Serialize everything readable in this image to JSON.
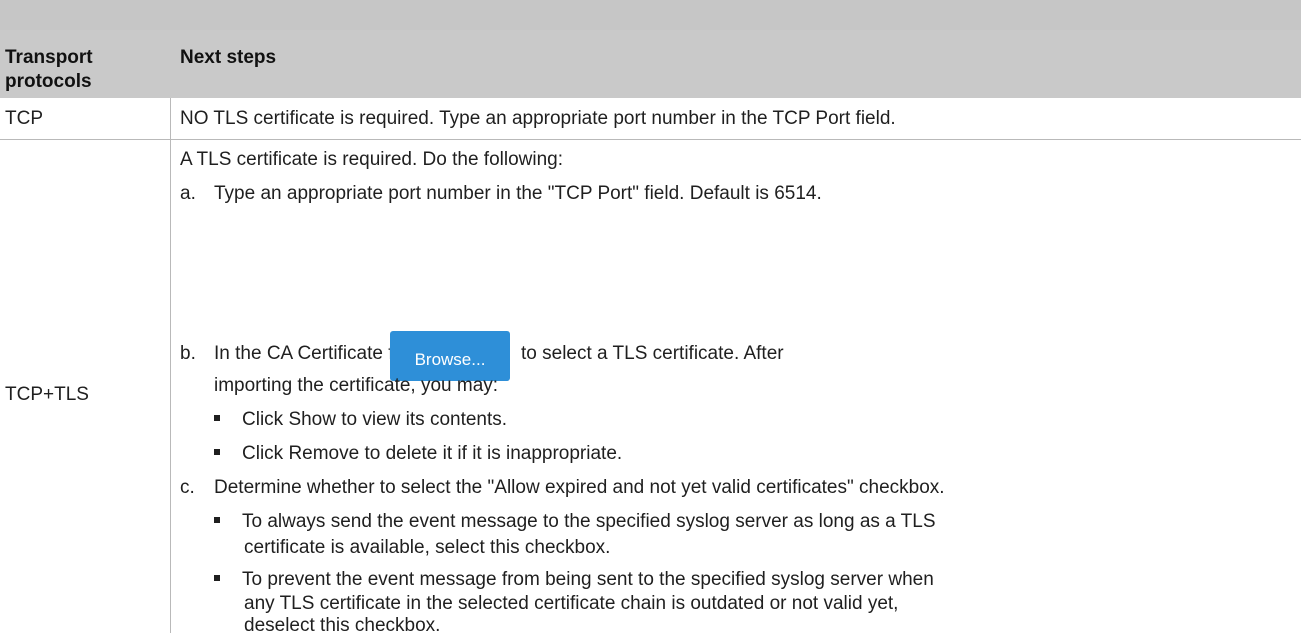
{
  "header": {
    "col1": "Transport",
    "col1_line2": "protocols",
    "col2": "Next steps"
  },
  "rows": {
    "tcp": {
      "protocol": "TCP",
      "step": "NO TLS certificate is required. Type an appropriate port number in the TCP Port field."
    },
    "tcptls": {
      "protocol": "TCP+TLS",
      "intro": "A TLS certificate is required. Do the following:",
      "a_marker": "a.",
      "a_text": "Type an appropriate port number in the \"TCP Port\" field. Default is 6514.",
      "b_marker": "b.",
      "b_text_before": "In the CA Certificate field, click",
      "b_button": "Browse...",
      "b_text_after": "to select a TLS certificate. After",
      "b_text_line2": "importing the certificate, you may:",
      "b_bullets": [
        "Click Show to view its contents.",
        "Click Remove to delete it if it is inappropriate."
      ],
      "c_marker": "c.",
      "c_text": "Determine whether to select the \"Allow expired and not yet valid certificates\" checkbox.",
      "c_bullet1_line1": "To always send the event message to the specified syslog server as long as a TLS",
      "c_bullet1_line2": "certificate is available, select this checkbox.",
      "c_bullet2_line1": "To prevent the event message from being sent to the specified syslog server when",
      "c_bullet2_line2": "any TLS certificate in the selected certificate chain is outdated or not valid yet,",
      "c_bullet2_line3": "deselect this checkbox."
    }
  },
  "colors": {
    "header_bg": "#c9c9c9",
    "button_bg": "#2e8fd8",
    "border": "#b9b9b9"
  }
}
